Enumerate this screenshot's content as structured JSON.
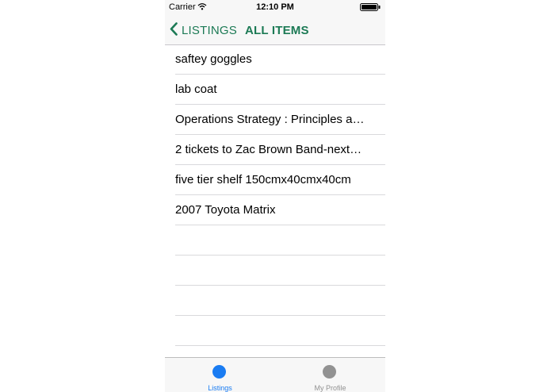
{
  "status_bar": {
    "carrier": "Carrier",
    "time": "12:10 PM",
    "wifi_icon": "wifi-icon",
    "battery_icon": "battery-icon"
  },
  "nav": {
    "back_label": "LISTINGS",
    "back_icon": "chevron-left-icon",
    "title": "ALL ITEMS",
    "accent_color": "#1c7a55"
  },
  "items": [
    {
      "label": "saftey goggles"
    },
    {
      "label": "lab coat"
    },
    {
      "label": "Operations Strategy : Principles a…"
    },
    {
      "label": "2 tickets to Zac Brown Band-next…"
    },
    {
      "label": "five tier shelf 150cmx40cmx40cm"
    },
    {
      "label": "2007 Toyota Matrix"
    }
  ],
  "tabbar": {
    "tabs": [
      {
        "label": "Listings",
        "active": true,
        "color": "#1a7cf2"
      },
      {
        "label": "My Profile",
        "active": false,
        "color": "#929292"
      }
    ]
  }
}
